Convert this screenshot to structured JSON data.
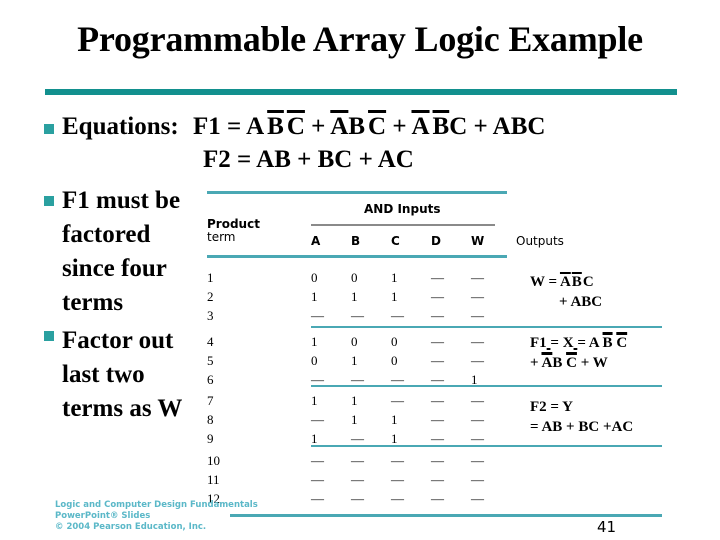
{
  "slide": {
    "title": "Programmable Array Logic Example",
    "page_number": "41",
    "footer": {
      "line1": "Logic and Computer Design Fundamentals",
      "line2": "PowerPoint® Slides",
      "line3": "© 2004 Pearson Education, Inc."
    },
    "accent_color": "#12908e"
  },
  "equations": {
    "label": "Equations:",
    "f1_prefix": "F1 = ",
    "f1_terms": [
      {
        "parts": [
          {
            "t": "A",
            "bar": false
          },
          {
            "t": "B",
            "bar": true
          },
          {
            "t": "C",
            "bar": true
          }
        ]
      },
      {
        "parts": [
          {
            "t": "A",
            "bar": true
          },
          {
            "t": "B",
            "bar": false
          },
          {
            "t": "C",
            "bar": true
          }
        ]
      },
      {
        "parts": [
          {
            "t": "A",
            "bar": true
          },
          {
            "t": "B",
            "bar": true
          },
          {
            "t": "C",
            "bar": false
          }
        ]
      },
      {
        "parts": [
          {
            "t": "A",
            "bar": false
          },
          {
            "t": "B",
            "bar": false
          },
          {
            "t": "C",
            "bar": false
          }
        ]
      }
    ],
    "f2": "F2 = AB + BC + AC"
  },
  "bullets": [
    {
      "lines": [
        "F1 must be",
        "factored",
        "since four",
        "terms"
      ]
    },
    {
      "lines": [
        "Factor out",
        "last two",
        "terms as W"
      ]
    }
  ],
  "table": {
    "group_header": "AND Inputs",
    "product_term_header": [
      "Product",
      "term"
    ],
    "columns": [
      "A",
      "B",
      "C",
      "D",
      "W"
    ],
    "outputs_header": "Outputs",
    "groups": [
      {
        "rows": [
          {
            "term": "1",
            "values": [
              "0",
              "0",
              "1",
              "—",
              "—"
            ]
          },
          {
            "term": "2",
            "values": [
              "1",
              "1",
              "1",
              "—",
              "—"
            ]
          },
          {
            "term": "3",
            "values": [
              "—",
              "—",
              "—",
              "—",
              "—"
            ]
          }
        ],
        "output": {
          "line1_label": "W = ",
          "line1_expr": [
            {
              "t": "A",
              "bar": true
            },
            {
              "t": "B",
              "bar": true
            },
            {
              "t": "C",
              "bar": false
            }
          ],
          "line2": "+ ABC"
        }
      },
      {
        "rows": [
          {
            "term": "4",
            "values": [
              "1",
              "0",
              "0",
              "—",
              "—"
            ]
          },
          {
            "term": "5",
            "values": [
              "0",
              "1",
              "0",
              "—",
              "—"
            ]
          },
          {
            "term": "6",
            "values": [
              "—",
              "—",
              "—",
              "—",
              "1"
            ]
          }
        ],
        "output": {
          "line1": "F1 = X = A B C",
          "line2": "+ AB C + W"
        }
      },
      {
        "rows": [
          {
            "term": "7",
            "values": [
              "1",
              "1",
              "—",
              "—",
              "—"
            ]
          },
          {
            "term": "8",
            "values": [
              "—",
              "1",
              "1",
              "—",
              "—"
            ]
          },
          {
            "term": "9",
            "values": [
              "1",
              "—",
              "1",
              "—",
              "—"
            ]
          }
        ],
        "output": {
          "line1": "F2 = Y",
          "line2": "= AB + BC +AC"
        }
      },
      {
        "rows": [
          {
            "term": "10",
            "values": [
              "—",
              "—",
              "—",
              "—",
              "—"
            ]
          },
          {
            "term": "11",
            "values": [
              "—",
              "—",
              "—",
              "—",
              "—"
            ]
          },
          {
            "term": "12",
            "values": [
              "—",
              "—",
              "—",
              "—",
              "—"
            ]
          }
        ],
        "output": null
      }
    ]
  }
}
